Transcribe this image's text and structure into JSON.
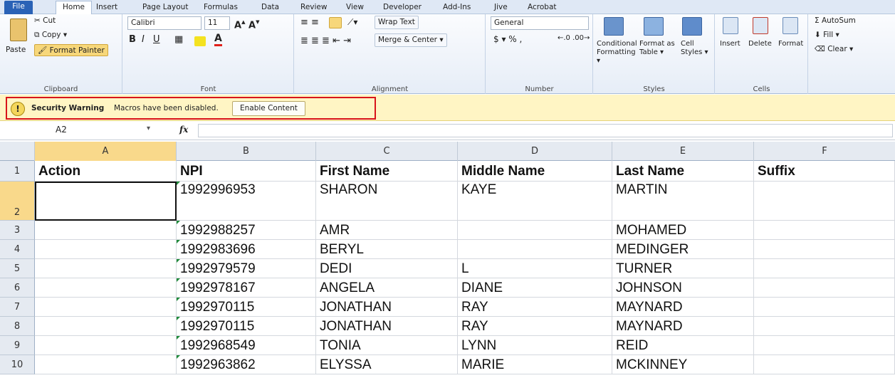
{
  "tabs": [
    "File",
    "Home",
    "Insert",
    "Page Layout",
    "Formulas",
    "Data",
    "Review",
    "View",
    "Developer",
    "Add-Ins",
    "Jive",
    "Acrobat"
  ],
  "clipboard": {
    "paste": "Paste",
    "cut": "Cut",
    "copy": "Copy ▾",
    "format_painter": "Format Painter",
    "label": "Clipboard"
  },
  "font": {
    "name": "Calibri",
    "size": "11",
    "label": "Font"
  },
  "alignment": {
    "wrap": "Wrap Text",
    "merge": "Merge & Center ▾",
    "label": "Alignment"
  },
  "number": {
    "format": "General",
    "symbols": "$ ▾ %  ,",
    "label": "Number"
  },
  "styles": {
    "conditional": "Conditional Formatting ▾",
    "format_table": "Format as Table ▾",
    "cell_styles": "Cell Styles ▾",
    "label": "Styles"
  },
  "cells": {
    "insert": "Insert",
    "delete": "Delete",
    "format": "Format",
    "label": "Cells"
  },
  "editing": {
    "autosum": "Σ AutoSum",
    "fill": "Fill ▾",
    "clear": "Clear ▾"
  },
  "security": {
    "title": "Security Warning",
    "message": "Macros have been disabled.",
    "button": "Enable Content"
  },
  "formula_bar": {
    "name_box": "A2",
    "fx": "fx",
    "value": ""
  },
  "columns": [
    "A",
    "B",
    "C",
    "D",
    "E",
    "F"
  ],
  "rows": [
    {
      "num": "1",
      "cells": [
        "Action",
        "NPI",
        "First Name",
        "Middle Name",
        "Last Name",
        "Suffix"
      ]
    },
    {
      "num": "2",
      "cells": [
        "",
        "1992996953",
        "SHARON",
        "KAYE",
        "MARTIN",
        ""
      ]
    },
    {
      "num": "3",
      "cells": [
        "",
        "1992988257",
        "AMR",
        "",
        "MOHAMED",
        ""
      ]
    },
    {
      "num": "4",
      "cells": [
        "",
        "1992983696",
        "BERYL",
        "",
        "MEDINGER",
        ""
      ]
    },
    {
      "num": "5",
      "cells": [
        "",
        "1992979579",
        "DEDI",
        "L",
        "TURNER",
        ""
      ]
    },
    {
      "num": "6",
      "cells": [
        "",
        "1992978167",
        "ANGELA",
        "DIANE",
        "JOHNSON",
        ""
      ]
    },
    {
      "num": "7",
      "cells": [
        "",
        "1992970115",
        "JONATHAN",
        "RAY",
        "MAYNARD",
        ""
      ]
    },
    {
      "num": "8",
      "cells": [
        "",
        "1992970115",
        "JONATHAN",
        "RAY",
        "MAYNARD",
        ""
      ]
    },
    {
      "num": "9",
      "cells": [
        "",
        "1992968549",
        "TONIA",
        "LYNN",
        "REID",
        ""
      ]
    },
    {
      "num": "10",
      "cells": [
        "",
        "1992963862",
        "ELYSSA",
        "MARIE",
        "MCKINNEY",
        ""
      ]
    }
  ]
}
